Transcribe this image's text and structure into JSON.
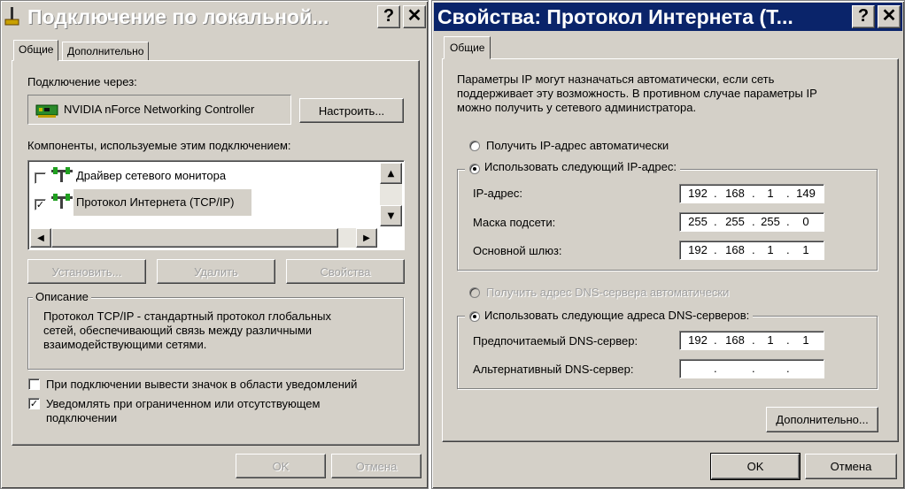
{
  "left_window": {
    "title": "Подключение по локальной...",
    "help_btn": "?",
    "close_btn": "✕",
    "tabs": [
      "Общие",
      "Дополнительно"
    ],
    "connect_via_label": "Подключение через:",
    "adapter_name": "NVIDIA nForce Networking Controller",
    "configure_btn": "Настроить...",
    "components_label": "Компоненты, используемые этим подключением:",
    "components": [
      {
        "label": "Драйвер сетевого монитора",
        "checked": false
      },
      {
        "label": "Протокол Интернета (TCP/IP)",
        "checked": true
      }
    ],
    "install_btn": "Установить...",
    "remove_btn": "Удалить",
    "properties_btn": "Свойства",
    "description_title": "Описание",
    "description_lines": [
      "Протокол TCP/IP - стандартный протокол глобальных",
      "сетей, обеспечивающий связь между различными",
      "взаимодействующими сетями."
    ],
    "tray_icon_label": "При подключении вывести значок в области уведомлений",
    "tray_icon_checked": false,
    "notify_lines": [
      "Уведомлять при ограниченном или отсутствующем",
      "подключении"
    ],
    "notify_checked": true,
    "ok_btn": "OK",
    "cancel_btn": "Отмена"
  },
  "right_window": {
    "title": "Свойства: Протокол Интернета (Т...",
    "help_btn": "?",
    "close_btn": "✕",
    "tab": "Общие",
    "intro_lines": [
      "Параметры IP могут назначаться автоматически, если сеть",
      "поддерживает эту возможность. В противном случае параметры IP",
      "можно получить у сетевого администратора."
    ],
    "auto_ip_label": "Получить IP-адрес автоматически",
    "manual_ip_label": "Использовать следующий IP-адрес:",
    "ip_label": "IP-адрес:",
    "ip_octets": [
      "192",
      "168",
      "1",
      "149"
    ],
    "mask_label": "Маска подсети:",
    "mask_octets": [
      "255",
      "255",
      "255",
      "0"
    ],
    "gateway_label": "Основной шлюз:",
    "gateway_octets": [
      "192",
      "168",
      "1",
      "1"
    ],
    "auto_dns_label": "Получить адрес DNS-сервера автоматически",
    "manual_dns_label": "Использовать следующие адреса DNS-серверов:",
    "pref_dns_label": "Предпочитаемый DNS-сервер:",
    "pref_dns_octets": [
      "192",
      "168",
      "1",
      "1"
    ],
    "alt_dns_label": "Альтернативный DNS-сервер:",
    "alt_dns_octets": [
      "",
      "",
      "",
      ""
    ],
    "advanced_btn": "Дополнительно...",
    "ok_btn": "OK",
    "cancel_btn": "Отмена"
  }
}
